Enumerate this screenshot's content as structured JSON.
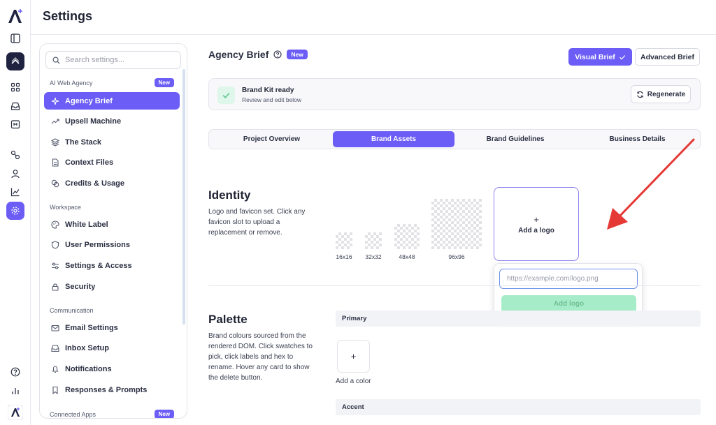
{
  "header": {
    "title": "Settings"
  },
  "sidebar": {
    "search_placeholder": "Search settings...",
    "groups": [
      {
        "label": "AI Web Agency",
        "badge": "New"
      },
      {
        "label": "Workspace"
      },
      {
        "label": "Communication"
      },
      {
        "label": "Connected Apps",
        "badge": "New"
      }
    ],
    "items": [
      {
        "label": "Agency Brief",
        "icon": "sparkle-icon",
        "active": true
      },
      {
        "label": "Upsell Machine",
        "icon": "trend-up-icon"
      },
      {
        "label": "The Stack",
        "icon": "layers-icon"
      },
      {
        "label": "Context Files",
        "icon": "file-icon"
      },
      {
        "label": "Credits & Usage",
        "icon": "coins-icon"
      },
      {
        "label": "White Label",
        "icon": "palette-icon"
      },
      {
        "label": "User Permissions",
        "icon": "shield-icon"
      },
      {
        "label": "Settings & Access",
        "icon": "sliders-icon"
      },
      {
        "label": "Security",
        "icon": "lock-icon"
      },
      {
        "label": "Email Settings",
        "icon": "mail-icon"
      },
      {
        "label": "Inbox Setup",
        "icon": "inbox-icon"
      },
      {
        "label": "Notifications",
        "icon": "bell-icon"
      },
      {
        "label": "Responses & Prompts",
        "icon": "bookmark-icon"
      }
    ]
  },
  "main": {
    "title": "Agency Brief",
    "title_badge": "New",
    "visual_brief_label": "Visual Brief",
    "advanced_brief_label": "Advanced Brief",
    "brand_kit": {
      "title": "Brand Kit ready",
      "subtitle": "Review and edit below",
      "regenerate_label": "Regenerate"
    },
    "tabs": [
      {
        "label": "Project Overview",
        "active": false
      },
      {
        "label": "Brand Assets",
        "active": true
      },
      {
        "label": "Brand Guidelines",
        "active": false
      },
      {
        "label": "Business Details",
        "active": false
      }
    ],
    "identity": {
      "heading": "Identity",
      "description": "Logo and favicon set. Click any favicon slot to upload a replacement or remove.",
      "favicons": [
        "16x16",
        "32x32",
        "48x48",
        "96x96"
      ],
      "logo_plus": "+",
      "logo_label": "Add a logo",
      "popover": {
        "placeholder": "https://example.com/logo.png",
        "button_label": "Add logo"
      }
    },
    "palette": {
      "heading": "Palette",
      "description": "Brand colours sourced from the rendered DOM. Click swatches to pick, click labels and hex to rename. Hover any card to show the delete button.",
      "primary_label": "Primary",
      "add_plus": "+",
      "add_color_label": "Add a color",
      "accent_label": "Accent"
    }
  },
  "colors": {
    "accent": "#6b5df5",
    "success_light": "#a7ecc8",
    "annotation_arrow": "#e53935"
  }
}
